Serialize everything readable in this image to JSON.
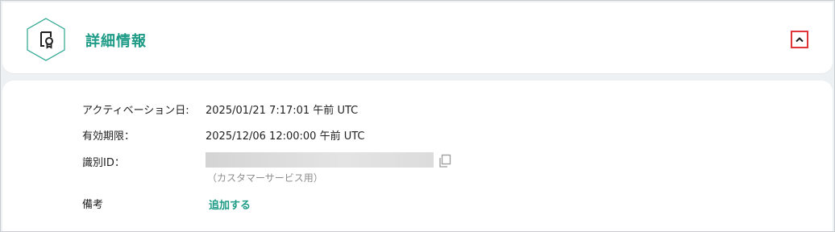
{
  "header": {
    "title": "詳細情報",
    "icon": "certificate-icon",
    "collapse_icon": "chevron-up-icon",
    "accent_color": "#1e9b86",
    "highlight_color": "#e0353b"
  },
  "details": {
    "activation_label": "アクティベーション日:",
    "activation_value": "2025/01/21 7:17:01 午前 UTC",
    "expiry_label": "有効期限：",
    "expiry_value": "2025/12/06 12:00:00 午前 UTC",
    "id_label": "識別ID：",
    "id_hint": "（カスタマーサービス用）",
    "copy_icon": "copy-icon",
    "notes_label": "備考",
    "notes_action": "追加する"
  }
}
